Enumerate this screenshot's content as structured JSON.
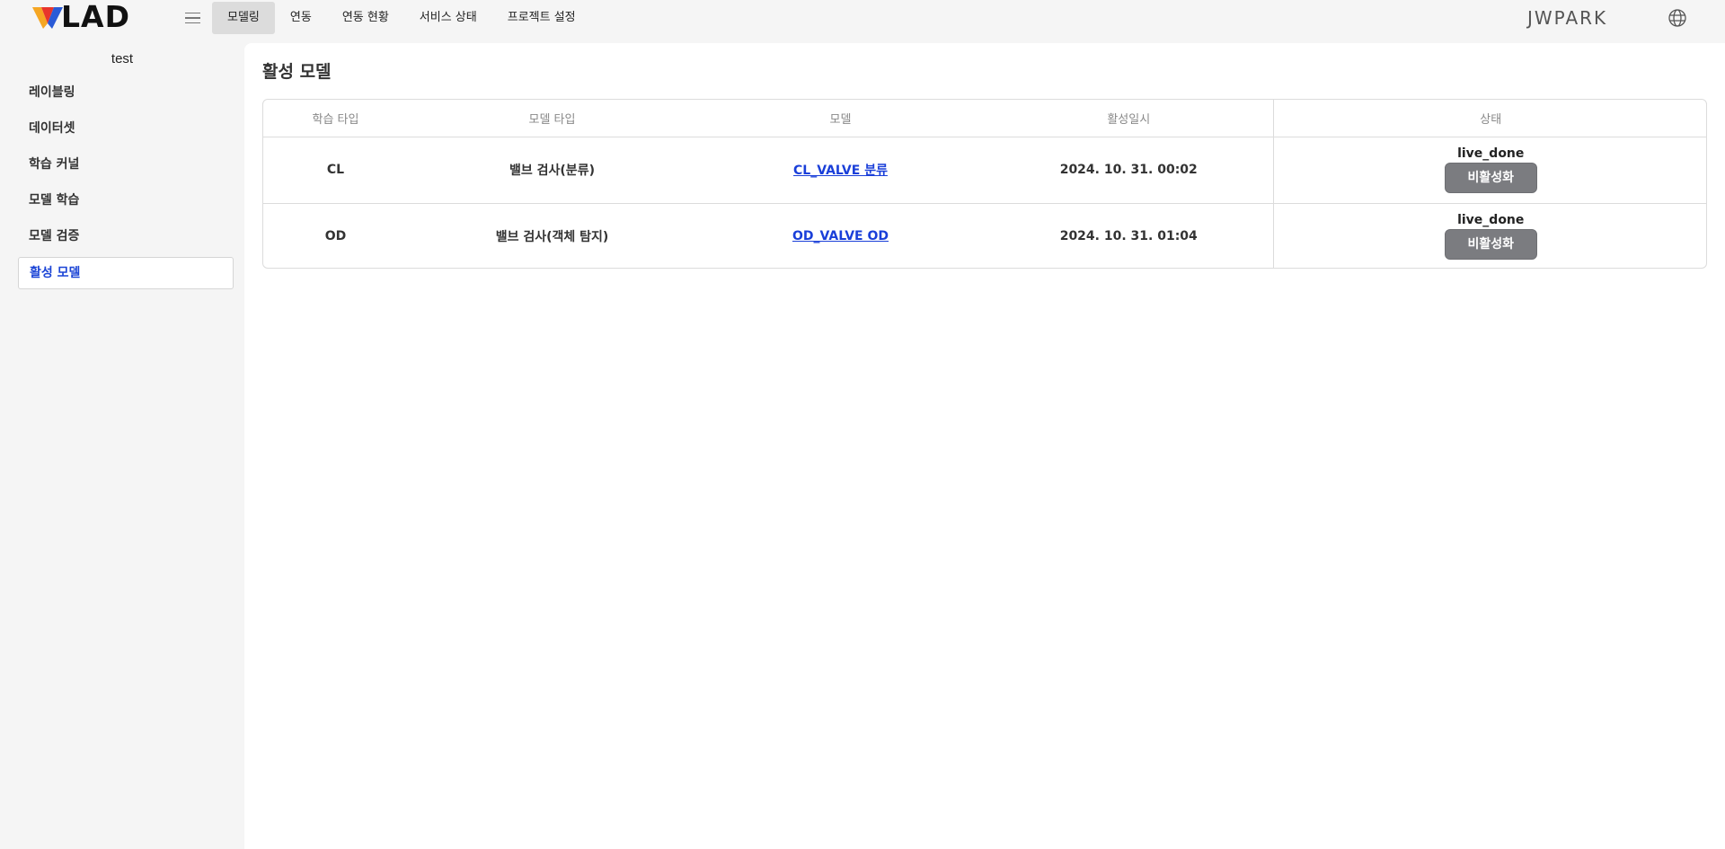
{
  "brand": {
    "logo_text": "LAD",
    "logo_colors": [
      "#f5a623",
      "#e8352b",
      "#2a5bd7"
    ]
  },
  "nav": {
    "tabs": [
      "모델링",
      "연동",
      "연동 현황",
      "서비스 상태",
      "프로젝트 설정"
    ],
    "active_index": 0
  },
  "user": {
    "name": "JWPARK"
  },
  "icons": {
    "menu": "hamburger-menu-icon",
    "language": "globe-icon"
  },
  "sidebar": {
    "project_name": "test",
    "items": [
      {
        "label": "레이블링"
      },
      {
        "label": "데이터셋"
      },
      {
        "label": "학습 커널"
      },
      {
        "label": "모델 학습"
      },
      {
        "label": "모델 검증"
      },
      {
        "label": "활성 모델"
      }
    ],
    "active_index": 5
  },
  "main": {
    "title": "활성 모델",
    "table": {
      "headers": [
        "학습 타입",
        "모델 타입",
        "모델",
        "활성일시",
        "상태"
      ],
      "rows": [
        {
          "train_type": "CL",
          "model_type": "밸브 검사(분류)",
          "model": "CL_VALVE 분류",
          "activated_at": "2024. 10. 31. 00:02",
          "status": "live_done",
          "action": "비활성화"
        },
        {
          "train_type": "OD",
          "model_type": "밸브 검사(객체 탐지)",
          "model": "OD_VALVE OD",
          "activated_at": "2024. 10. 31. 01:04",
          "status": "live_done",
          "action": "비활성화"
        }
      ]
    }
  },
  "colors": {
    "accent": "#1c45d6",
    "link": "#1a3fd9",
    "button": "#7b7c80"
  }
}
